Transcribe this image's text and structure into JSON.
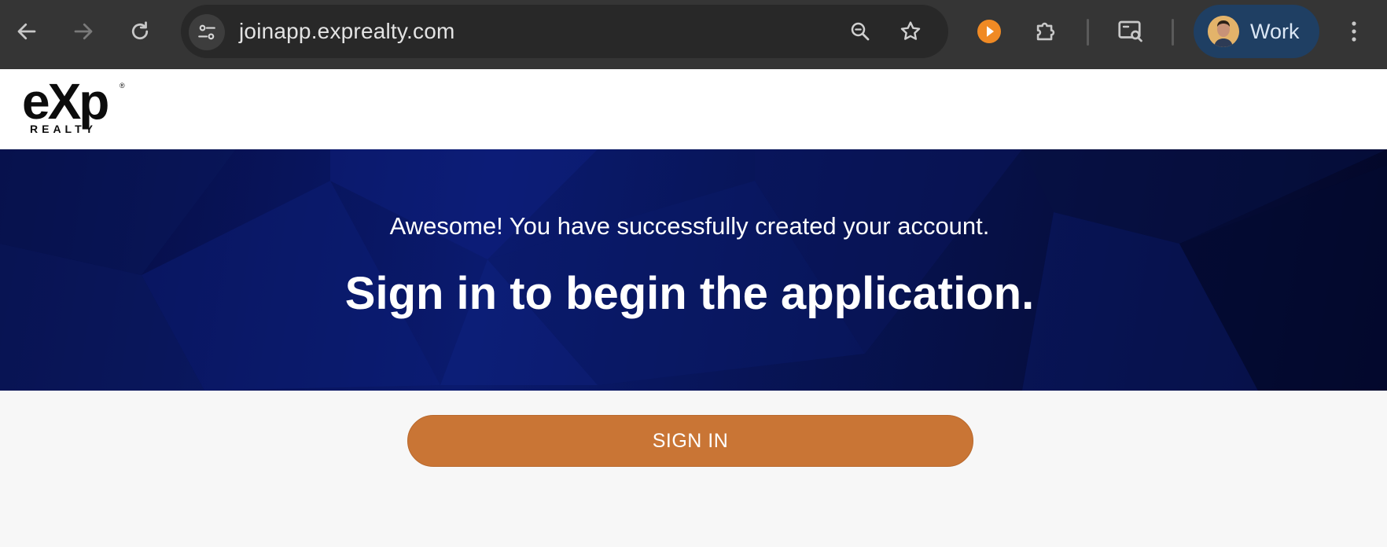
{
  "browser": {
    "url": "joinapp.exprealty.com",
    "profile_label": "Work",
    "icons": [
      "back-icon",
      "forward-icon",
      "reload-icon",
      "site-settings-icon",
      "zoom-icon",
      "bookmark-star-icon",
      "extension-play-icon",
      "extensions-puzzle-icon",
      "search-tab-icon",
      "menu-icon"
    ]
  },
  "header": {
    "logo_text": "eXp",
    "logo_subtext": "REALTY",
    "logo_reg": "®"
  },
  "hero": {
    "subtitle": "Awesome! You have successfully created your account.",
    "title": "Sign in to begin the application."
  },
  "actions": {
    "signin_label": "SIGN IN"
  },
  "colors": {
    "toolbar": "#353535",
    "hero_dark": "#050b3e",
    "button": "#c97535",
    "profile_pill": "#1f3f63"
  }
}
